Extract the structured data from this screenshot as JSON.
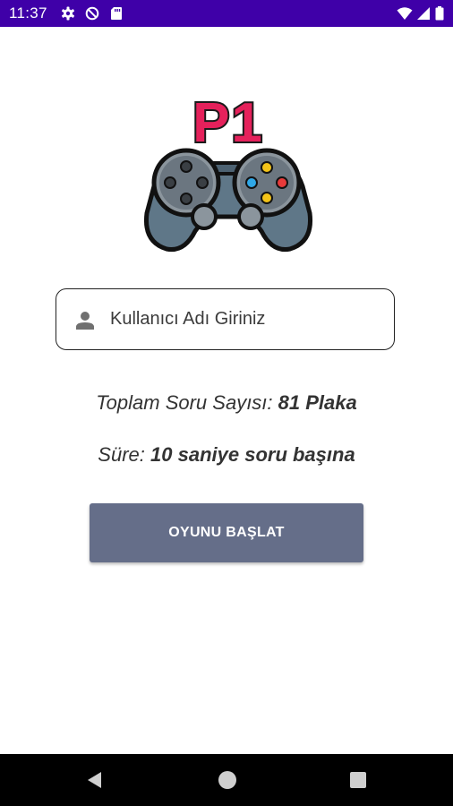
{
  "status_bar": {
    "time": "11:37",
    "left_icons": [
      "settings-gear-icon",
      "do-not-disturb-icon",
      "sd-card-icon"
    ],
    "right_icons": [
      "wifi-icon",
      "cellular-signal-icon",
      "battery-icon"
    ],
    "background_color": "#3f00a8"
  },
  "logo": {
    "text": "P1",
    "icon": "gamepad-icon",
    "text_color": "#e5215b",
    "body_color": "#5f7788"
  },
  "username": {
    "icon": "person-icon",
    "placeholder": "Kullanıcı Adı Giriniz",
    "value": ""
  },
  "info": {
    "total_label": "Toplam Soru Sayısı:",
    "total_value": "81 Plaka",
    "time_label": "Süre:",
    "time_value": "10 saniye soru başına"
  },
  "start_button": {
    "label": "OYUNU BAŞLAT",
    "color": "#656e89"
  },
  "nav_bar": {
    "buttons": [
      "back-icon",
      "home-icon",
      "recents-icon"
    ]
  }
}
